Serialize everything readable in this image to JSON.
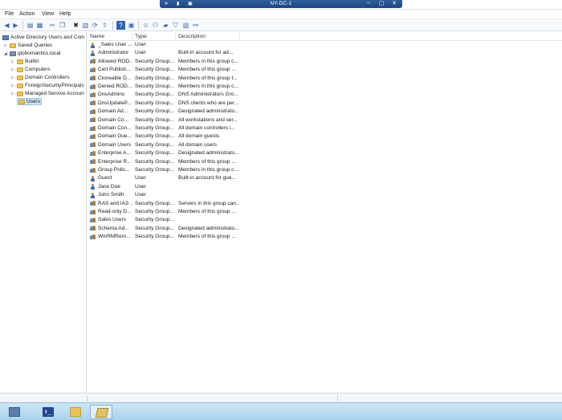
{
  "rdp": {
    "host": "NY-DC-1",
    "minimize": "–",
    "restore": "▢",
    "close": "✕"
  },
  "menu": [
    "File",
    "Action",
    "View",
    "Help"
  ],
  "tree": {
    "root": "Active Directory Users and Com",
    "saved_queries": "Saved Queries",
    "domain": "globomantics.local",
    "children": [
      "Builtin",
      "Computers",
      "Domain Controllers",
      "ForeignSecurityPrincipals",
      "Managed Service Accoun",
      "Users"
    ],
    "selected": "Users"
  },
  "columns": {
    "name": "Name",
    "type": "Type",
    "description": "Description"
  },
  "rows": [
    {
      "icon": "user-icon",
      "name": "_Sales User ...",
      "type": "User",
      "description": ""
    },
    {
      "icon": "user-icon",
      "name": "Administrator",
      "type": "User",
      "description": "Built-in account for ad..."
    },
    {
      "icon": "group-icon",
      "name": "Allowed ROD...",
      "type": "Security Group...",
      "description": "Members in this group c..."
    },
    {
      "icon": "group-icon",
      "name": "Cert Publish...",
      "type": "Security Group...",
      "description": "Members of this group ..."
    },
    {
      "icon": "group-icon",
      "name": "Cloneable D...",
      "type": "Security Group...",
      "description": "Members of this group t..."
    },
    {
      "icon": "group-icon",
      "name": "Denied ROD...",
      "type": "Security Group...",
      "description": "Members in this group c..."
    },
    {
      "icon": "group-icon",
      "name": "DnsAdmins",
      "type": "Security Group...",
      "description": "DNS Administrators Gro..."
    },
    {
      "icon": "group-icon",
      "name": "DnsUpdateP...",
      "type": "Security Group...",
      "description": "DNS clients who are per..."
    },
    {
      "icon": "group-icon",
      "name": "Domain Ad...",
      "type": "Security Group...",
      "description": "Designated administrato..."
    },
    {
      "icon": "group-icon",
      "name": "Domain Co...",
      "type": "Security Group...",
      "description": "All workstations and ser..."
    },
    {
      "icon": "group-icon",
      "name": "Domain Con...",
      "type": "Security Group...",
      "description": "All domain controllers i..."
    },
    {
      "icon": "group-icon",
      "name": "Domain Gue...",
      "type": "Security Group...",
      "description": "All domain guests"
    },
    {
      "icon": "group-icon",
      "name": "Domain Users",
      "type": "Security Group...",
      "description": "All domain users"
    },
    {
      "icon": "group-icon",
      "name": "Enterprise A...",
      "type": "Security Group...",
      "description": "Designated administrato..."
    },
    {
      "icon": "group-icon",
      "name": "Enterprise R...",
      "type": "Security Group...",
      "description": "Members of this group ..."
    },
    {
      "icon": "group-icon",
      "name": "Group Polic...",
      "type": "Security Group...",
      "description": "Members in this group c..."
    },
    {
      "icon": "user-icon",
      "name": "Guest",
      "type": "User",
      "description": "Built-in account for gue..."
    },
    {
      "icon": "user-icon",
      "name": "Jane Doe",
      "type": "User",
      "description": ""
    },
    {
      "icon": "user-icon",
      "name": "John Smith",
      "type": "User",
      "description": ""
    },
    {
      "icon": "group-icon",
      "name": "RAS and IAS ...",
      "type": "Security Group...",
      "description": "Servers in this group can..."
    },
    {
      "icon": "group-icon",
      "name": "Read-only D...",
      "type": "Security Group...",
      "description": "Members of this group ..."
    },
    {
      "icon": "group-icon",
      "name": "Sales Users",
      "type": "Security Group...",
      "description": ""
    },
    {
      "icon": "group-icon",
      "name": "Schema Ad...",
      "type": "Security Group...",
      "description": "Designated administrato..."
    },
    {
      "icon": "group-icon",
      "name": "WinRMRem...",
      "type": "Security Group...",
      "description": "Members of this group ..."
    }
  ],
  "colors": {
    "rdp_bar": "#1c4680",
    "selection": "#cde2f7",
    "taskbar": "#a9d2ec"
  }
}
